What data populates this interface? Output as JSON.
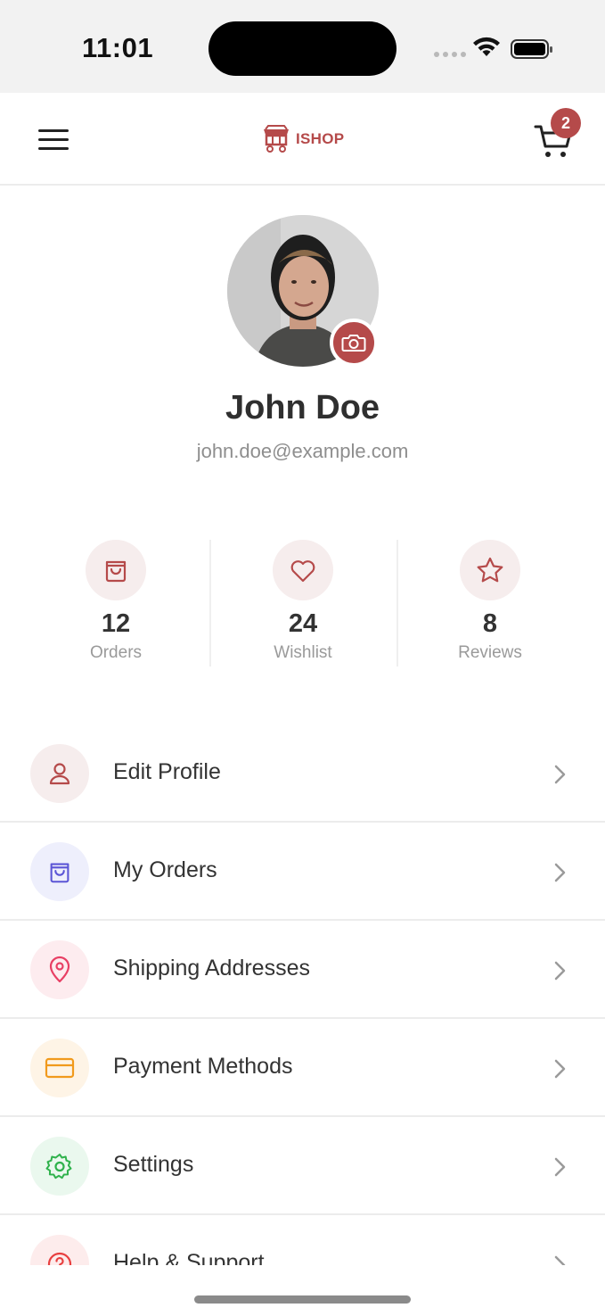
{
  "status_bar": {
    "time": "11:01"
  },
  "header": {
    "logo_text": "ISHOP",
    "cart_count": "2"
  },
  "profile": {
    "name": "John Doe",
    "email": "john.doe@example.com"
  },
  "stats": [
    {
      "value": "12",
      "label": "Orders",
      "icon": "shopping-bag-icon"
    },
    {
      "value": "24",
      "label": "Wishlist",
      "icon": "heart-icon"
    },
    {
      "value": "8",
      "label": "Reviews",
      "icon": "star-icon"
    }
  ],
  "menu": [
    {
      "label": "Edit Profile",
      "icon": "user-icon",
      "color": "#b54a4a",
      "bg": "#f6eded"
    },
    {
      "label": "My Orders",
      "icon": "shopping-bag-icon",
      "color": "#5b55d6",
      "bg": "#eeeffc"
    },
    {
      "label": "Shipping Addresses",
      "icon": "location-pin-icon",
      "color": "#e83f64",
      "bg": "#fdecef"
    },
    {
      "label": "Payment Methods",
      "icon": "credit-card-icon",
      "color": "#f19a1c",
      "bg": "#fef4e6"
    },
    {
      "label": "Settings",
      "icon": "gear-icon",
      "color": "#2fb24c",
      "bg": "#eaf8ee"
    },
    {
      "label": "Help & Support",
      "icon": "help-circle-icon",
      "color": "#e83f3f",
      "bg": "#fdecec"
    }
  ],
  "colors": {
    "accent": "#b54a4a"
  }
}
